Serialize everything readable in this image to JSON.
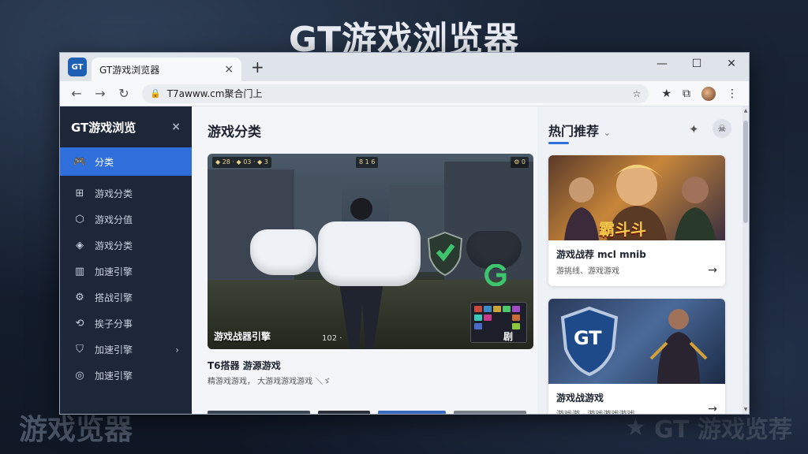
{
  "background": {
    "title": "GT游戏浏览器",
    "bottom_left": "游戏览器",
    "bottom_right": "GT 游戏览荐"
  },
  "window": {
    "tab": {
      "icon_text": "GT",
      "title": "GT游戏浏览器",
      "close": "×",
      "new_tab": "+"
    },
    "controls": {
      "minimize": "—",
      "maximize": "☐",
      "close": "✕"
    },
    "toolbar": {
      "back": "←",
      "forward": "→",
      "reload": "↻",
      "address": "T7awww.cm聚合门上",
      "lock": "🔒",
      "bookmark_star": "☆",
      "icons": {
        "favorites": "★",
        "collections": "⧉",
        "menu": "⋮"
      }
    },
    "sidebar": {
      "title": "GT游戏浏览",
      "close": "×",
      "items": [
        {
          "label": "分类",
          "icon": "gamepad-icon",
          "glyph": "🎮",
          "active": true
        },
        {
          "label": "游戏分类",
          "icon": "gamepad-outline-icon",
          "glyph": "⊞"
        },
        {
          "label": "游戏分值",
          "icon": "hexagon-icon",
          "glyph": "⬡"
        },
        {
          "label": "游戏分类",
          "icon": "diamond-icon",
          "glyph": "◈"
        },
        {
          "label": "加速引擎",
          "icon": "chart-icon",
          "glyph": "▥"
        },
        {
          "label": "搭战引擎",
          "icon": "gear-icon",
          "glyph": "⚙"
        },
        {
          "label": "挨子分事",
          "icon": "refresh-icon",
          "glyph": "⟲"
        },
        {
          "label": "加速引擎",
          "icon": "shield-icon",
          "glyph": "⛉",
          "chevron": "›"
        },
        {
          "label": "加速引擎",
          "icon": "target-icon",
          "glyph": "◎"
        }
      ]
    },
    "main": {
      "heading": "游戏分类",
      "hero": {
        "caption": "游戏战器引擎",
        "timer": "102 ·",
        "mini_label": "剧",
        "hud_left": "◆ 28 · ◆ 03 · ◆ 3",
        "hud_mid": "8 1 6",
        "hud_right": "⚙ 0"
      },
      "subtitle": "T6搭器 游源游戏",
      "description": "精游戏游戏， 大游戏游戏游戏 ＼ゞ"
    },
    "right": {
      "heading": "热门推荐",
      "chevron": "⌄",
      "cards": [
        {
          "title": "游戏战荐 mcl mnib",
          "desc": "游挑线、游戏游戏",
          "art_text": "霸斗斗",
          "arrow": "→"
        },
        {
          "title": "游戏战游戏",
          "desc": "游戏游 · 游戏游戏游戏",
          "art_text": "GT",
          "arrow": "→"
        }
      ]
    }
  },
  "colors": {
    "accent": "#2f6fdc",
    "sidebar_bg": "#1d2738",
    "page_bg": "#f3f5f8"
  }
}
